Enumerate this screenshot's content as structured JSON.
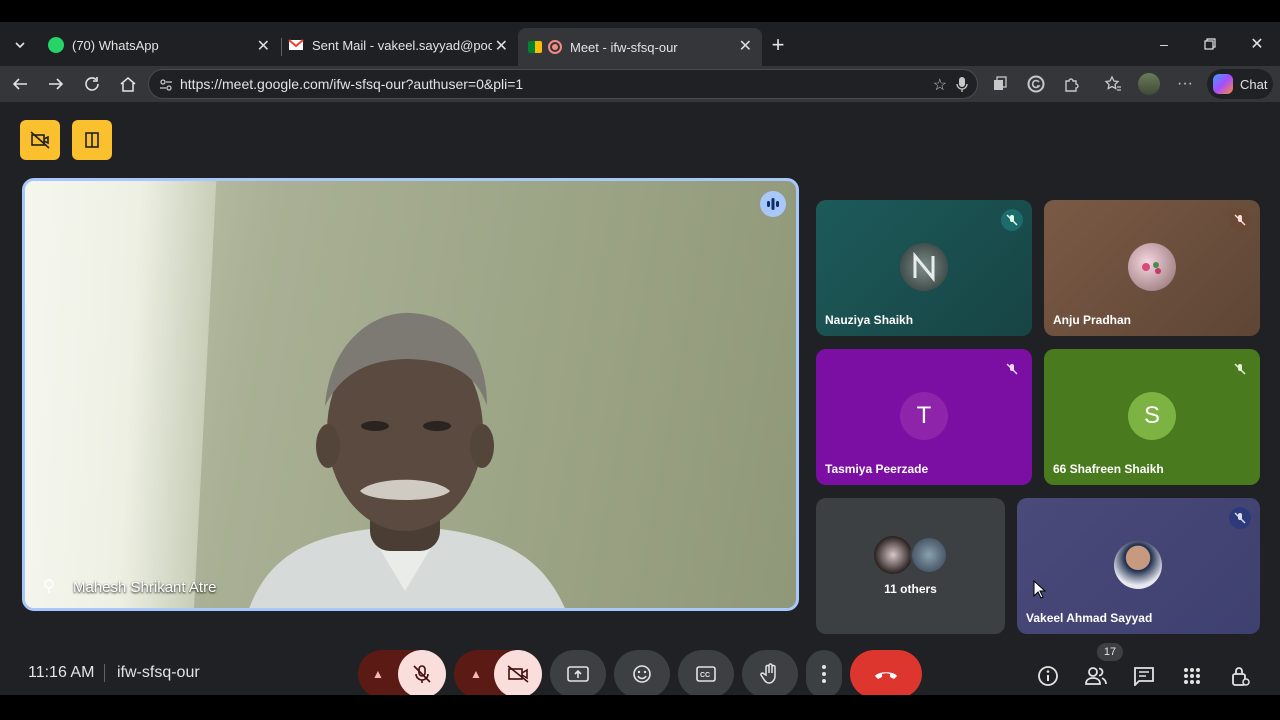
{
  "browser": {
    "tabs": [
      {
        "title": "(70) WhatsApp",
        "icon": "whatsapp-icon"
      },
      {
        "title": "Sent Mail - vakeel.sayyad@poonawallafincorp",
        "icon": "gmail-icon"
      },
      {
        "title": "Meet - ifw-sfsq-our",
        "icon": "meet-icon"
      }
    ],
    "url": "https://meet.google.com/ifw-sfsq-our?authuser=0&pli=1",
    "chat_label": "Chat"
  },
  "meet": {
    "main_speaker": "Mahesh Shrikant Atre",
    "tiles": [
      {
        "name": "Nauziya Shaikh",
        "muted": true
      },
      {
        "name": "Anju Pradhan",
        "muted": true
      },
      {
        "name": "Tasmiya Peerzade",
        "initial": "T",
        "muted": true
      },
      {
        "name": "66 Shafreen Shaikh",
        "initial": "S",
        "muted": true
      },
      {
        "name": "Vakeel Ahmad Sayyad",
        "muted": true
      }
    ],
    "others_label": "11 others",
    "time": "11:16 AM",
    "meeting_code": "ifw-sfsq-our",
    "participant_count": "17"
  },
  "colors": {
    "accent": "#a8c7fa",
    "end_call": "#dc362e",
    "yellow": "#fbc02d"
  }
}
